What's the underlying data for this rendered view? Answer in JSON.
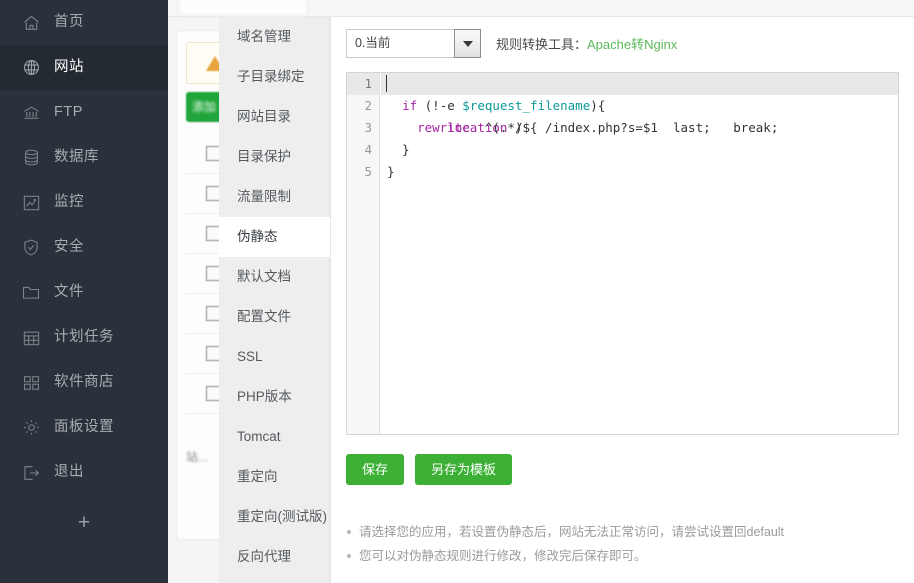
{
  "sidebar": {
    "items": [
      {
        "label": "首页",
        "icon": "home-icon",
        "active": false
      },
      {
        "label": "网站",
        "icon": "globe-icon",
        "active": true
      },
      {
        "label": "FTP",
        "icon": "ftp-icon",
        "active": false
      },
      {
        "label": "数据库",
        "icon": "database-icon",
        "active": false
      },
      {
        "label": "监控",
        "icon": "monitor-icon",
        "active": false
      },
      {
        "label": "安全",
        "icon": "shield-icon",
        "active": false
      },
      {
        "label": "文件",
        "icon": "folder-icon",
        "active": false
      },
      {
        "label": "计划任务",
        "icon": "calendar-icon",
        "active": false
      },
      {
        "label": "软件商店",
        "icon": "grid-icon",
        "active": false
      },
      {
        "label": "面板设置",
        "icon": "gear-icon",
        "active": false
      },
      {
        "label": "退出",
        "icon": "logout-icon",
        "active": false
      }
    ],
    "add_label": "+"
  },
  "submenu": {
    "items": [
      {
        "label": "域名管理",
        "active": false
      },
      {
        "label": "子目录绑定",
        "active": false
      },
      {
        "label": "网站目录",
        "active": false
      },
      {
        "label": "目录保护",
        "active": false
      },
      {
        "label": "流量限制",
        "active": false
      },
      {
        "label": "伪静态",
        "active": true
      },
      {
        "label": "默认文档",
        "active": false
      },
      {
        "label": "配置文件",
        "active": false
      },
      {
        "label": "SSL",
        "active": false
      },
      {
        "label": "PHP版本",
        "active": false
      },
      {
        "label": "Tomcat",
        "active": false
      },
      {
        "label": "重定向",
        "active": false
      },
      {
        "label": "重定向(测试版)",
        "active": false
      },
      {
        "label": "反向代理",
        "active": false
      }
    ]
  },
  "toolbar": {
    "select_value": "0.当前",
    "converter_label": "规则转换工具：",
    "converter_link": "Apache转Nginx",
    "link_color": "#5cb85c"
  },
  "editor": {
    "active_line": 1,
    "lines": [
      {
        "num": "1",
        "segments": [
          {
            "text": "location",
            "type": "kw"
          },
          {
            "text": " / {",
            "type": "plain"
          }
        ]
      },
      {
        "num": "2",
        "segments": [
          {
            "text": "  ",
            "type": "plain"
          },
          {
            "text": "if",
            "type": "kw"
          },
          {
            "text": " (!-e ",
            "type": "plain"
          },
          {
            "text": "$request_filename",
            "type": "var"
          },
          {
            "text": "){",
            "type": "plain"
          }
        ]
      },
      {
        "num": "3",
        "segments": [
          {
            "text": "    ",
            "type": "plain"
          },
          {
            "text": "rewrite",
            "type": "kw"
          },
          {
            "text": "  ^(.*)$  /index.php?s=$1  last;   break;",
            "type": "plain"
          }
        ]
      },
      {
        "num": "4",
        "segments": [
          {
            "text": "  }",
            "type": "plain"
          }
        ]
      },
      {
        "num": "5",
        "segments": [
          {
            "text": "}",
            "type": "plain"
          }
        ]
      }
    ]
  },
  "buttons": {
    "save": "保存",
    "save_as_template": "另存为模板",
    "color": "#3cb034"
  },
  "notes": [
    "请选择您的应用，若设置伪静态后，网站无法正常访问，请尝试设置回default",
    "您可以对伪静态规则进行修改，修改完后保存即可。"
  ],
  "background": {
    "button_label": "添加",
    "footer_text": "站..."
  }
}
